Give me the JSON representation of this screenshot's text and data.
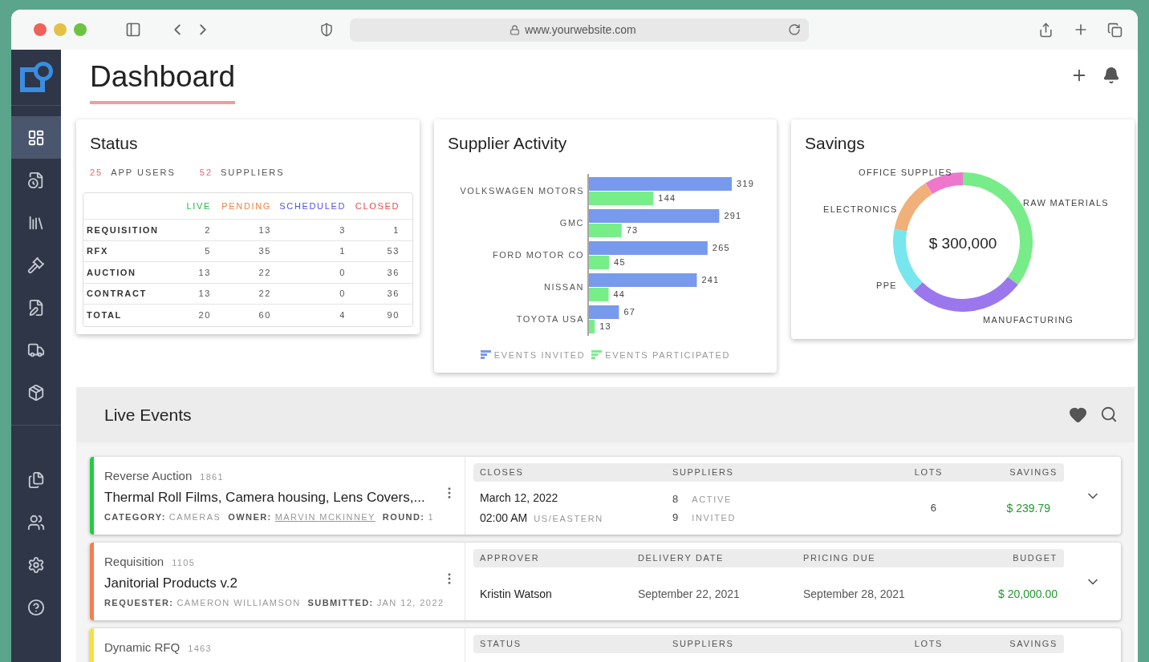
{
  "browser": {
    "url": "www.yourwebsite.com"
  },
  "sidebar": {
    "items": [
      {
        "selected": true
      },
      {
        "selected": false
      },
      {
        "selected": false
      },
      {
        "selected": false
      },
      {
        "selected": false
      },
      {
        "selected": false
      },
      {
        "selected": false
      }
    ],
    "bottom_items": [
      {
        "selected": false
      },
      {
        "selected": false
      },
      {
        "selected": false
      },
      {
        "selected": false
      }
    ]
  },
  "page": {
    "title": "Dashboard"
  },
  "status": {
    "title": "Status",
    "stats": [
      {
        "count": "25",
        "label": "APP USERS"
      },
      {
        "count": "52",
        "label": "SUPPLIERS"
      }
    ],
    "columns": [
      {
        "label": "LIVE",
        "color": "#22bb44"
      },
      {
        "label": "PENDING",
        "color": "#f58040"
      },
      {
        "label": "SCHEDULED",
        "color": "#5050f0"
      },
      {
        "label": "CLOSED",
        "color": "#f04848"
      }
    ],
    "rows": [
      {
        "label": "REQUISITION",
        "cells": [
          "2",
          "13",
          "3",
          "1"
        ]
      },
      {
        "label": "RFX",
        "cells": [
          "5",
          "35",
          "1",
          "53"
        ]
      },
      {
        "label": "AUCTION",
        "cells": [
          "13",
          "22",
          "0",
          "36"
        ]
      },
      {
        "label": "CONTRACT",
        "cells": [
          "13",
          "22",
          "0",
          "36"
        ]
      },
      {
        "label": "TOTAL",
        "cells": [
          "20",
          "60",
          "4",
          "90"
        ]
      }
    ]
  },
  "supplier_activity": {
    "title": "Supplier Activity",
    "chart_data": {
      "type": "bar",
      "orientation": "horizontal",
      "data_labels": true,
      "categories": [
        "VOLKSWAGEN MOTORS",
        "GMC",
        "FORD MOTOR CO",
        "NISSAN",
        "TOYOTA USA"
      ],
      "series": [
        {
          "name": "EVENTS INVITED",
          "color": "#7799ee",
          "values": [
            319,
            291,
            265,
            241,
            67
          ]
        },
        {
          "name": "EVENTS PARTICIPATED",
          "color": "#77ee88",
          "values": [
            144,
            73,
            45,
            44,
            13
          ]
        }
      ]
    }
  },
  "savings": {
    "title": "Savings",
    "total": "$ 300,000",
    "segments": [
      {
        "label": "OFFICE SUPPLIES",
        "color": "#ee77cc"
      },
      {
        "label": "RAW MATERIALS",
        "color": "#77ec88"
      },
      {
        "label": "ELECTRONICS",
        "color": "#f0b07a"
      },
      {
        "label": "PPE",
        "color": "#77e6ee"
      },
      {
        "label": "MANUFACTURING",
        "color": "#9b77ee"
      }
    ]
  },
  "live_events": {
    "title": "Live Events",
    "events": [
      {
        "kind": "auction",
        "color": "#22cc44",
        "type": "Reverse Auction",
        "number": "1861",
        "title": "Thermal Roll Films, Camera housing, Lens Covers,...",
        "meta": [
          {
            "label": "CATEGORY:",
            "value": "CAMERAS",
            "link": false
          },
          {
            "label": "OWNER:",
            "value": "MARVIN MCKINNEY",
            "link": true
          },
          {
            "label": "ROUND:",
            "value": "1",
            "link": false
          }
        ],
        "columns": [
          "CLOSES",
          "SUPPLIERS",
          "LOTS",
          "SAVINGS"
        ],
        "closes": {
          "date": "March 12, 2022",
          "time": "02:00 AM",
          "zone": "US/EASTERN"
        },
        "suppliers": [
          {
            "count": "8",
            "label": "ACTIVE"
          },
          {
            "count": "9",
            "label": "INVITED"
          }
        ],
        "lots": "6",
        "savings": "$ 239.79"
      },
      {
        "kind": "requisition",
        "color": "#f08050",
        "type": "Requisition",
        "number": "1105",
        "title": "Janitorial Products v.2",
        "meta": [
          {
            "label": "REQUESTER:",
            "value": "CAMERON WILLIAMSON",
            "link": false
          },
          {
            "label": "SUBMITTED:",
            "value": "JAN 12, 2022",
            "link": false
          }
        ],
        "columns": [
          "APPROVER",
          "DELIVERY DATE",
          "PRICING DUE",
          "BUDGET"
        ],
        "values": [
          "Kristin Watson",
          "September 22, 2021",
          "September 28, 2021",
          "$ 20,000.00"
        ]
      },
      {
        "kind": "rfq",
        "color": "#f5e040",
        "type": "Dynamic RFQ",
        "number": "1463",
        "columns": [
          "STATUS",
          "SUPPLIERS",
          "LOTS",
          "SAVINGS"
        ]
      }
    ]
  }
}
